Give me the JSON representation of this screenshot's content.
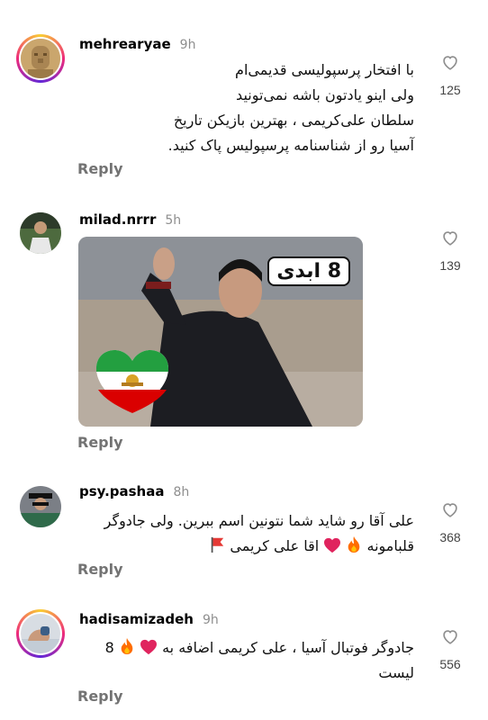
{
  "colors": {
    "like_icon": "#8e8e8e",
    "reply": "#737373",
    "flag": "#e53935",
    "heart": "#e0245e",
    "fire": "#ff6d00"
  },
  "comments": [
    {
      "username": "mehrearyae",
      "time": "9h",
      "lines": [
        "با افتخار پرسپولیسی قدیمی‌ام",
        "ولی اینو یادتون باشه نمی‌تونید",
        "سلطان علی‌کریمی ، بهترین بازیکن تاریخ",
        "آسیا رو از شناسنامه پرسپولیس پاک کنید."
      ],
      "likes": "125",
      "reply": "Reply",
      "avatar_icon": "statue-avatar-icon"
    },
    {
      "username": "milad.nrrr",
      "time": "5h",
      "gif_badge": "8 ابدی",
      "likes": "139",
      "reply": "Reply",
      "avatar_icon": "person-avatar-icon"
    },
    {
      "username": "psy.pashaa",
      "time": "8h",
      "line1": "علی آقا رو شاید شما نتونین اسم ببرین. ولی جادوگر",
      "line2": "قلبامونه",
      "line2b": "اقا علی کریمی",
      "likes": "368",
      "reply": "Reply",
      "avatar_icon": "person-avatar-icon"
    },
    {
      "username": "hadisamizadeh",
      "time": "9h",
      "line1_prefix": "8",
      "line1": "جادوگر فوتبال آسیا ، علی کریمی اضافه به",
      "line2": "لیست",
      "likes": "556",
      "reply": "Reply",
      "avatar_icon": "hand-avatar-icon"
    }
  ]
}
